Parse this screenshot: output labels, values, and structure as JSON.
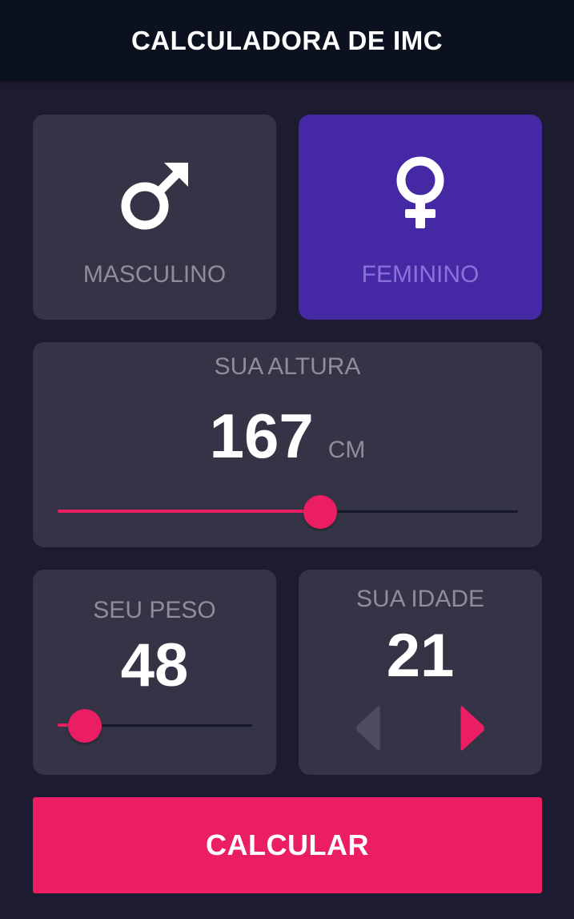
{
  "app": {
    "title": "CALCULADORA DE IMC"
  },
  "colors": {
    "background": "#1d1b30",
    "appbar": "#0c1120",
    "card": "#353446",
    "card_selected": "#4528a4",
    "accent": "#eb1e63",
    "label": "#8d8e98"
  },
  "gender": {
    "selected": "female",
    "options": [
      {
        "id": "male",
        "label": "MASCULINO",
        "icon": "male-symbol-icon"
      },
      {
        "id": "female",
        "label": "FEMININO",
        "icon": "female-symbol-icon"
      }
    ]
  },
  "height": {
    "title": "SUA ALTURA",
    "value": "167",
    "unit": "CM",
    "slider_fraction": 0.57
  },
  "weight": {
    "title": "SEU PESO",
    "value": "48",
    "slider_fraction": 0.14
  },
  "age": {
    "title": "SUA IDADE",
    "value": "21",
    "decrement_icon": "triangle-left-icon",
    "increment_icon": "triangle-right-icon"
  },
  "calculate": {
    "label": "CALCULAR"
  }
}
